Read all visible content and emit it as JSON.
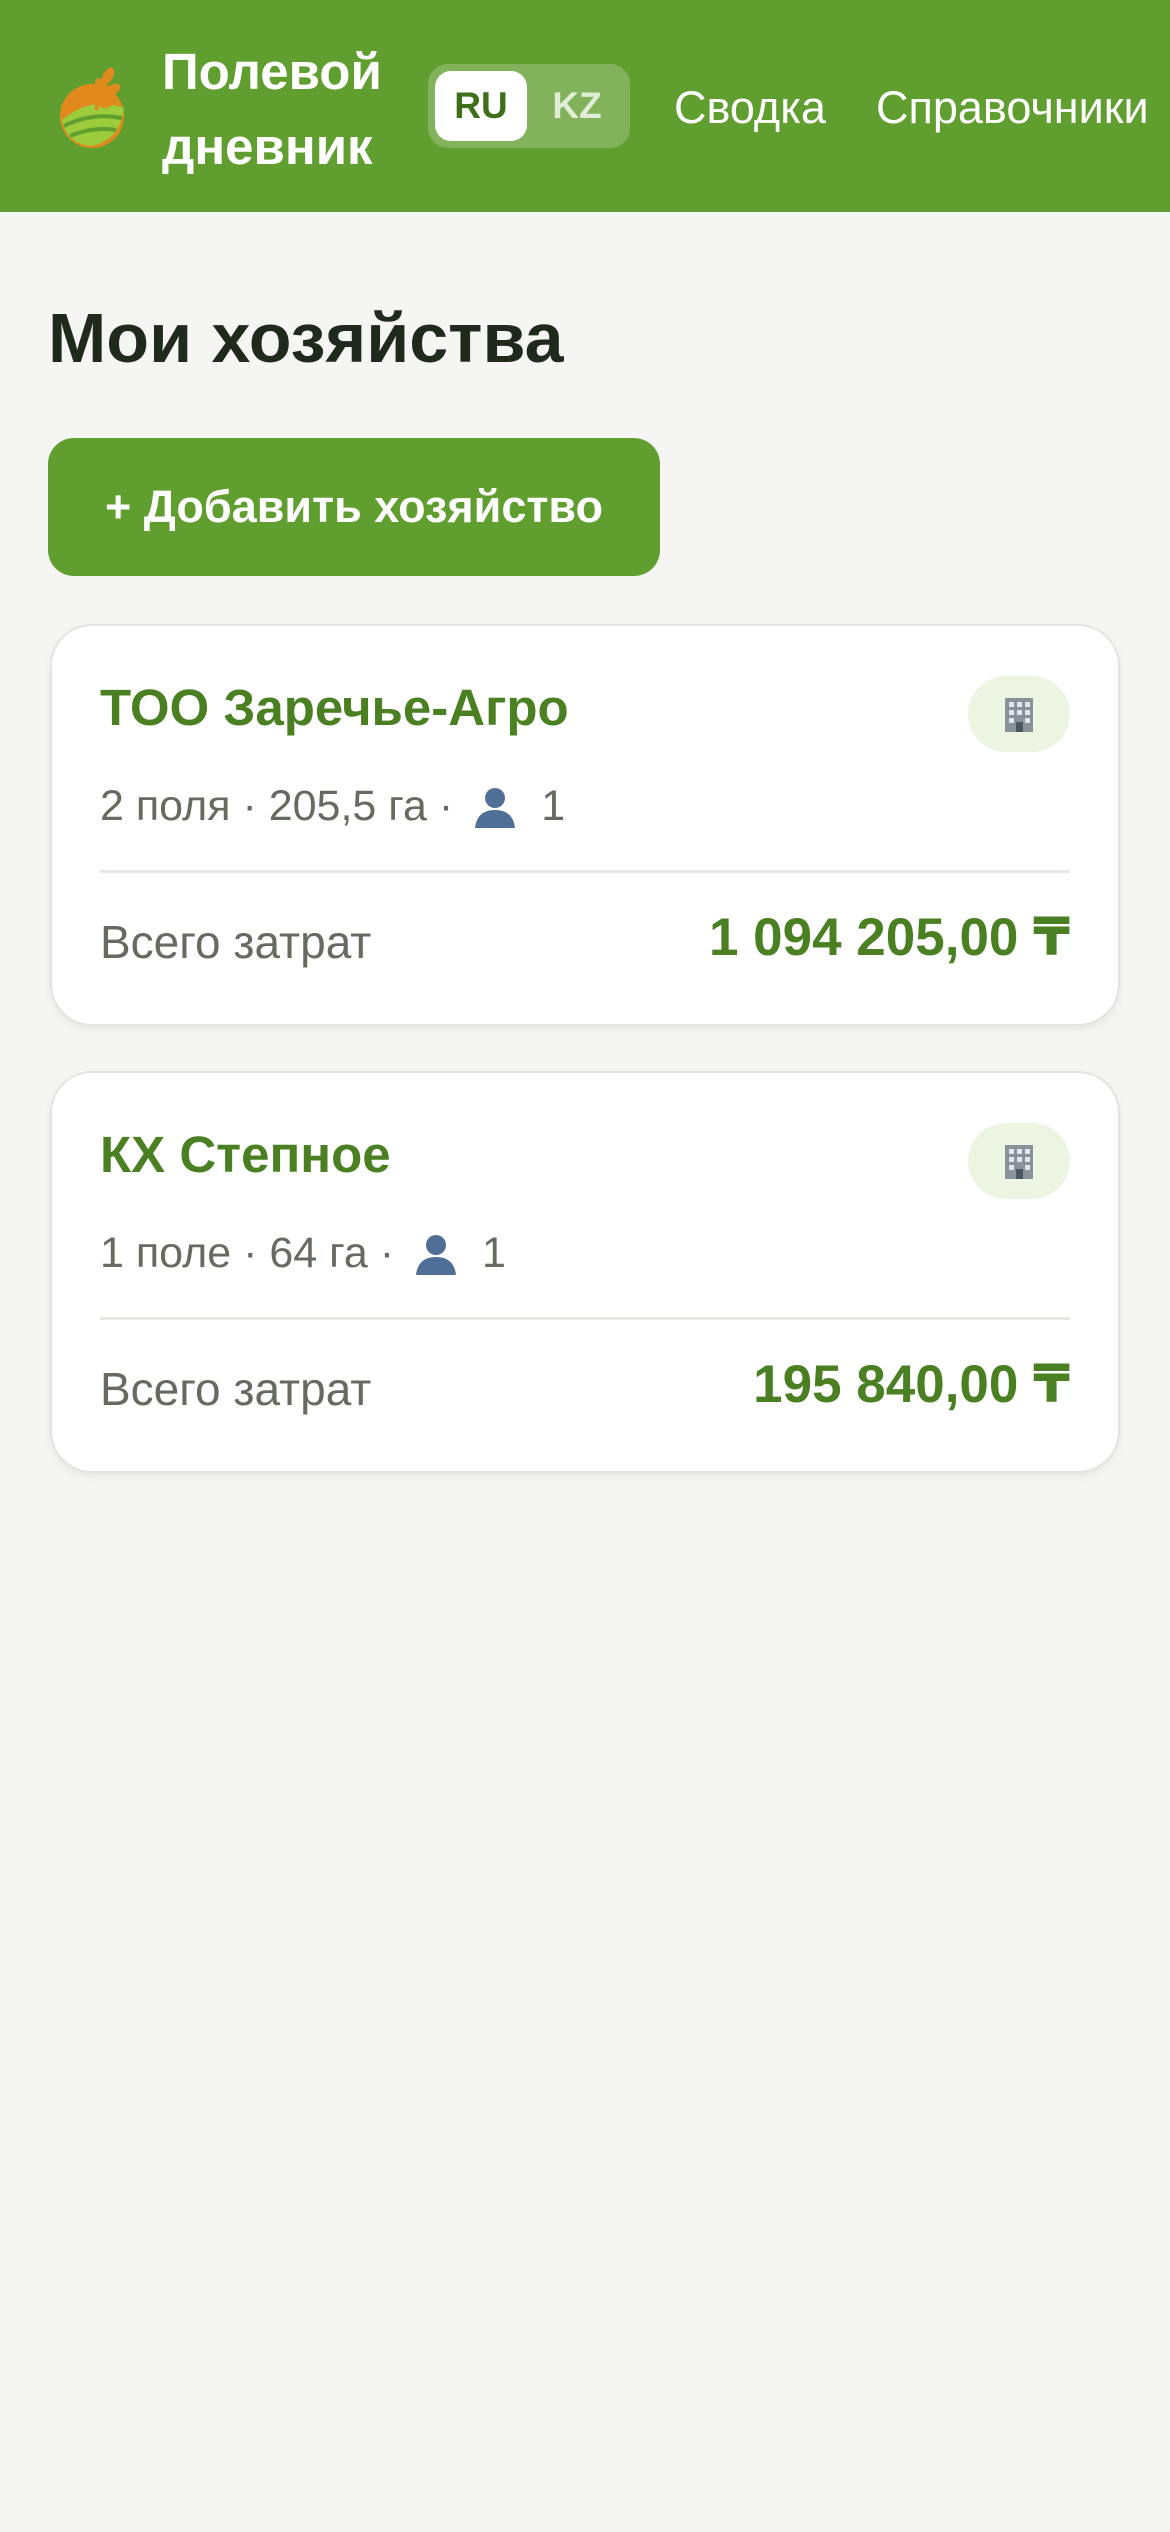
{
  "header": {
    "app_title_line1": "Полевой",
    "app_title_line2": "дневник",
    "lang": {
      "ru": "RU",
      "kz": "KZ",
      "active": "RU"
    },
    "nav": {
      "summary": "Сводка",
      "references": "Справочники"
    },
    "colors": {
      "brand": "#5f9e2f",
      "accent_text": "#4a7f22"
    }
  },
  "main": {
    "page_title": "Мои хозяйства",
    "add_button": "+ Добавить хозяйство",
    "farms": [
      {
        "name": "ТОО Заречье-Агро",
        "badge_icon": "building-icon",
        "meta_text": "2 поля · 205,5 га ·",
        "user_icon": "person-icon",
        "user_count": "1",
        "total_label": "Всего затрат",
        "total_value": "1 094 205,00 ₸"
      },
      {
        "name": "КХ Степное",
        "badge_icon": "building-icon",
        "meta_text": "1 поле · 64 га ·",
        "user_icon": "person-icon",
        "user_count": "1",
        "total_label": "Всего затрат",
        "total_value": "195 840,00 ₸"
      }
    ]
  }
}
